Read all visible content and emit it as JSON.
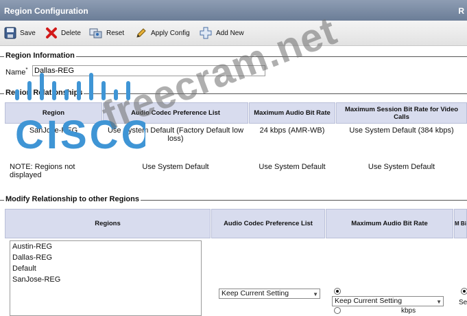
{
  "window": {
    "title": "Region Configuration",
    "title_right": "R"
  },
  "toolbar": {
    "save_label": "Save",
    "delete_label": "Delete",
    "reset_label": "Reset",
    "apply_label": "Apply Config",
    "add_label": "Add New"
  },
  "region_info": {
    "heading": "Region Information",
    "name_label": "Name",
    "required_mark": "*",
    "name_value": "Dallas-REG"
  },
  "relationships": {
    "heading": "Region Relationships",
    "headers": [
      "Region",
      "Audio Codec Preference List",
      "Maximum Audio Bit Rate",
      "Maximum Session Bit Rate for Video Calls"
    ],
    "rows": [
      [
        "SanJose-REG",
        "Use System Default (Factory Default low loss)",
        "24 kbps (AMR-WB)",
        "Use System Default (384 kbps)"
      ],
      [
        "NOTE: Regions not displayed",
        "Use System Default",
        "Use System Default",
        "Use System Default"
      ]
    ]
  },
  "modify": {
    "heading": "Modify Relationship to other Regions",
    "headers": [
      "Regions",
      "Audio Codec Preference List",
      "Maximum Audio Bit Rate",
      "M Bi"
    ],
    "regions": [
      "Austin-REG",
      "Dallas-REG",
      "Default",
      "SanJose-REG"
    ],
    "codec_select": "Keep Current Setting",
    "bitrate_select": "Keep Current Setting",
    "kbps_label": "kbps",
    "partial_label": "Se"
  },
  "watermark": {
    "text": "freecram.net",
    "logo_text": "CISCO"
  },
  "colors": {
    "title_bar": "#7686a0",
    "header_fill": "#d8dcee",
    "logo_blue": "#3f95d5"
  }
}
